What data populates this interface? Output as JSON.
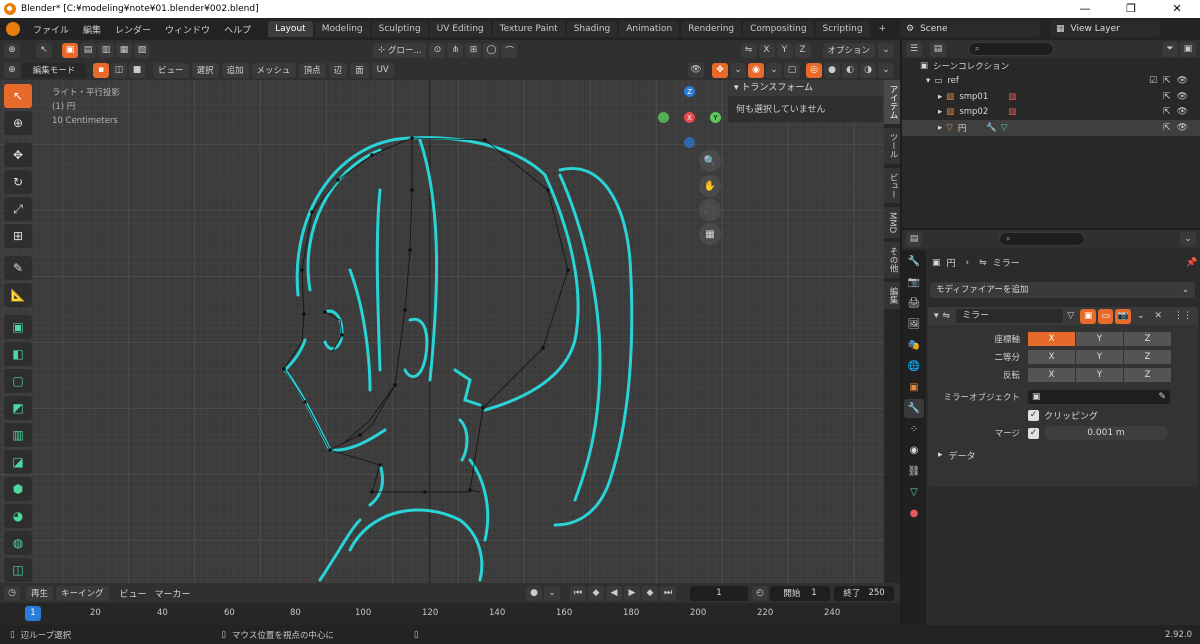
{
  "window": {
    "title": "Blender* [C:¥modeling¥note¥01.blender¥002.blend]"
  },
  "menu": [
    "ファイル",
    "編集",
    "レンダー",
    "ウィンドウ",
    "ヘルプ"
  ],
  "workspaces": [
    "Layout",
    "Modeling",
    "Sculpting",
    "UV Editing",
    "Texture Paint",
    "Shading",
    "Animation",
    "Rendering",
    "Compositing",
    "Scripting"
  ],
  "scene": {
    "name": "Scene",
    "view_layer": "View Layer"
  },
  "viewport_header": {
    "transform_orientation": "グロー...",
    "axes": [
      "X",
      "Y",
      "Z"
    ],
    "options": "オプション",
    "mode": "編集モード",
    "menus": [
      "ビュー",
      "選択",
      "追加",
      "メッシュ",
      "頂点",
      "辺",
      "面",
      "UV"
    ]
  },
  "viewport_info": {
    "line1": "ライト・平行投影",
    "line2": "(1) 円",
    "line3": "10 Centimeters"
  },
  "npanel": {
    "title": "トランスフォーム",
    "body": "何も選択していません",
    "tabs": [
      "アイテム",
      "ツール",
      "ビュー",
      "MMD",
      "その他",
      "編集"
    ]
  },
  "gizmo": {
    "z": "Z",
    "x": "X",
    "y": "Y"
  },
  "timeline": {
    "menus": [
      "再生",
      "キーイング",
      "ビュー",
      "マーカー"
    ],
    "current_frame": "1",
    "start_label": "開始",
    "start": "1",
    "end_label": "終了",
    "end": "250",
    "ticks": [
      "20",
      "40",
      "60",
      "80",
      "100",
      "120",
      "140",
      "160",
      "180",
      "200",
      "220",
      "240"
    ],
    "cursor": "1"
  },
  "statusbar": {
    "left": "辺ループ選択",
    "mid": "マウス位置を視点の中心に",
    "version": "2.92.0"
  },
  "outliner": {
    "root": "シーンコレクション",
    "items": [
      {
        "name": "ref",
        "indent": 1
      },
      {
        "name": "smp01",
        "indent": 2
      },
      {
        "name": "smp02",
        "indent": 2
      },
      {
        "name": "円",
        "indent": 2
      }
    ]
  },
  "properties": {
    "breadcrumb_object": "円",
    "breadcrumb_modifier": "ミラー",
    "add_modifier": "モディファイアーを追加",
    "modifier_name": "ミラー",
    "axis_label": "座標軸",
    "bisect_label": "二等分",
    "flip_label": "反転",
    "xyz": [
      "X",
      "Y",
      "Z"
    ],
    "mirror_object_label": "ミラーオブジェクト",
    "clipping_label": "クリッピング",
    "merge_label": "マージ",
    "merge_value": "0.001 m",
    "data_label": "データ"
  },
  "colors": {
    "accent": "#e86a2a",
    "line_art": "#29d3d6",
    "selection_blue": "#2b7bd8"
  }
}
